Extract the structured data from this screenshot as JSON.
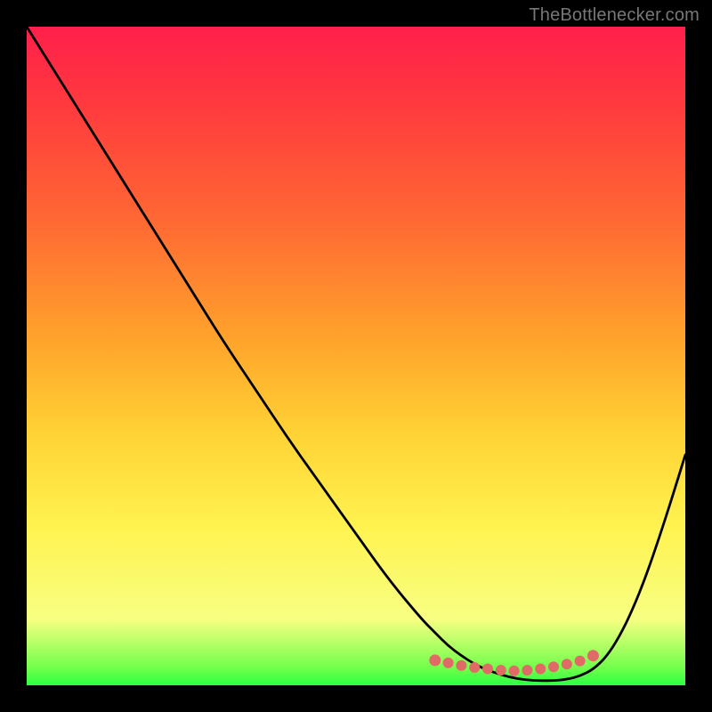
{
  "source_label": "TheBottlenecker.com",
  "colors": {
    "gradient_top": "#ff1f4b",
    "gradient_mid1": "#ff6a33",
    "gradient_mid2": "#ffd335",
    "gradient_mid3": "#fff350",
    "gradient_bottom": "#2aff43",
    "curve": "#000000",
    "beads": "#e06a66",
    "bg": "#000000",
    "source_text": "#777777"
  },
  "chart_data": {
    "type": "line",
    "title": "",
    "xlabel": "",
    "ylabel": "",
    "xlim": [
      0,
      100
    ],
    "ylim": [
      0,
      100
    ],
    "x": [
      0,
      5,
      10,
      15,
      20,
      25,
      30,
      35,
      40,
      45,
      50,
      55,
      60,
      62,
      64,
      66,
      68,
      70,
      72,
      74,
      76,
      78,
      80,
      82,
      84,
      86,
      88,
      90,
      92,
      94,
      96,
      98,
      100
    ],
    "values": [
      100,
      92,
      84,
      76,
      68,
      60,
      52,
      44.5,
      37,
      30,
      23,
      16,
      10,
      8,
      6,
      4.5,
      3.2,
      2.3,
      1.6,
      1.1,
      0.8,
      0.7,
      0.7,
      0.9,
      1.4,
      2.4,
      4.3,
      7.4,
      11.5,
      16.5,
      22.3,
      28.5,
      35
    ],
    "bead_points": {
      "x": [
        62,
        64,
        66,
        68,
        70,
        72,
        74,
        76,
        78,
        80,
        82,
        84,
        86
      ],
      "y": [
        3.8,
        3.4,
        3.0,
        2.7,
        2.5,
        2.3,
        2.2,
        2.3,
        2.5,
        2.8,
        3.2,
        3.7,
        4.5
      ]
    }
  }
}
